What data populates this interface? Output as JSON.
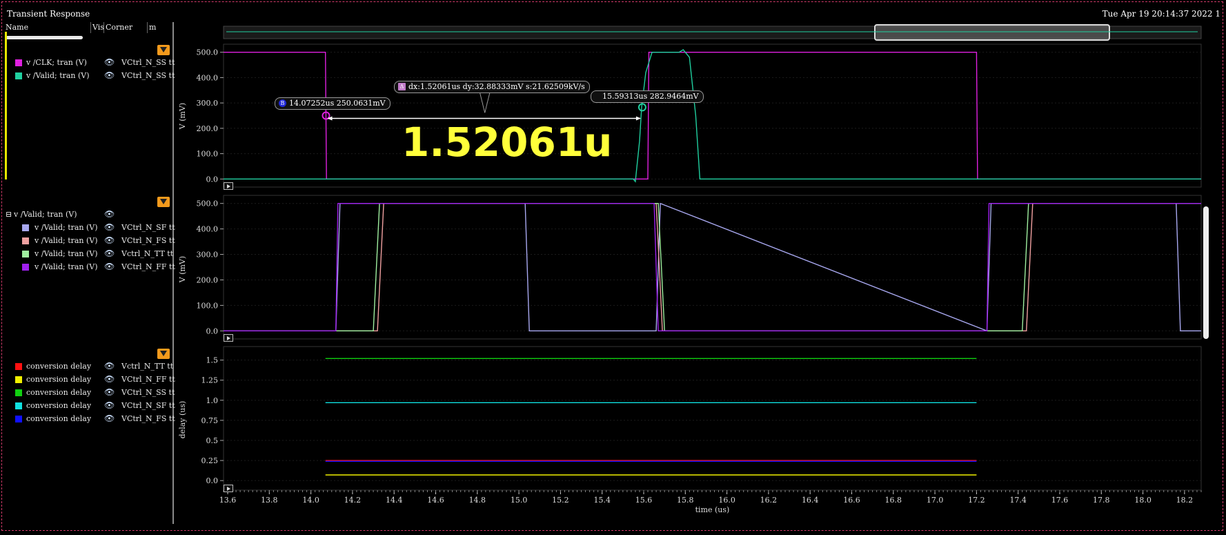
{
  "window": {
    "title": "Transient Response",
    "datetime": "Tue Apr 19 20:14:37 2022  1"
  },
  "browser": {
    "columns": {
      "name": "Name",
      "vis": "Vis",
      "corner": "Corner",
      "m": "m"
    }
  },
  "legend_groups": [
    {
      "items": [
        {
          "label": "v /CLK; tran (V)",
          "corner": "VCtrl_N_SS  tt",
          "color": "#e020e0"
        },
        {
          "label": "v /Valid; tran (V)",
          "corner": "VCtrl_N_SS  tt",
          "color": "#20d0a0"
        }
      ]
    },
    {
      "header": "v /Valid; tran (V)",
      "items": [
        {
          "label": "v /Valid; tran (V)",
          "corner": "VCtrl_N_SF  tt",
          "color": "#a8a8f0"
        },
        {
          "label": "v /Valid; tran (V)",
          "corner": "VCtrl_N_FS  tt",
          "color": "#f0a0a0"
        },
        {
          "label": "v /Valid; tran (V)",
          "corner": "Vctrl_N_TT  tt",
          "color": "#a0f0a0"
        },
        {
          "label": "v /Valid; tran (V)",
          "corner": "VCtrl_N_FF  tt",
          "color": "#a020f0"
        }
      ]
    },
    {
      "items": [
        {
          "label": "conversion delay",
          "corner": "Vctrl_N_TT  tt",
          "color": "#ff1010"
        },
        {
          "label": "conversion delay",
          "corner": "VCtrl_N_FF  tt",
          "color": "#f0f000"
        },
        {
          "label": "conversion delay",
          "corner": "VCtrl_N_SS  tt",
          "color": "#10d010"
        },
        {
          "label": "conversion delay",
          "corner": "VCtrl_N_SF  tt",
          "color": "#10e0e0"
        },
        {
          "label": "conversion delay",
          "corner": "VCtrl_N_FS  tt",
          "color": "#1010ff"
        }
      ]
    }
  ],
  "markers": {
    "a": {
      "label": "14.07252us 250.0631mV",
      "id": "B"
    },
    "b": {
      "label": "15.59313us 282.9464mV"
    },
    "delta": {
      "label": "dx:1.52061us dy:32.88333mV s:21.62509kV/s",
      "id": "Δ"
    }
  },
  "annotation": {
    "text": "1.52061u"
  },
  "colors": {
    "accent_frame": "#d23a6a",
    "annotation": "#ffff3a"
  },
  "chart_data": [
    {
      "type": "line",
      "ylabel": "V (mV)",
      "xlim": [
        13.58,
        18.28
      ],
      "ylim": [
        -10,
        510
      ],
      "yticks": [
        "0.0",
        "100.0",
        "200.0",
        "300.0",
        "400.0",
        "500.0"
      ],
      "series": [
        {
          "name": "v /CLK; tran (V)",
          "color": "#e020e0",
          "x": [
            13.58,
            14.07,
            14.075,
            15.62,
            15.625,
            17.2,
            17.205,
            18.28
          ],
          "y": [
            500,
            500,
            0,
            0,
            500,
            500,
            0,
            0
          ]
        },
        {
          "name": "v /Valid; tran (V)",
          "color": "#20d0a0",
          "x": [
            13.58,
            15.55,
            15.56,
            15.58,
            15.59,
            15.61,
            15.64,
            15.77,
            15.79,
            15.82,
            15.85,
            15.87,
            18.28
          ],
          "y": [
            0,
            0,
            -10,
            150,
            283,
            420,
            500,
            500,
            510,
            480,
            250,
            0,
            0
          ]
        }
      ]
    },
    {
      "type": "line",
      "ylabel": "V (mV)",
      "xlim": [
        13.58,
        18.28
      ],
      "ylim": [
        -10,
        510
      ],
      "yticks": [
        "0.0",
        "100.0",
        "200.0",
        "300.0",
        "400.0",
        "500.0"
      ],
      "series": [
        {
          "name": "v /Valid; tran (V) VCtrl_N_SF",
          "color": "#a8a8f0",
          "x": [
            13.58,
            14.12,
            14.14,
            15.03,
            15.05,
            15.66,
            15.68,
            17.25,
            17.27,
            18.16,
            18.18,
            18.28
          ],
          "y": [
            0,
            0,
            500,
            500,
            0,
            0,
            500,
            0,
            500,
            500,
            0,
            0
          ]
        },
        {
          "name": "v /Valid; tran (V) VCtrl_N_FS",
          "color": "#f0a0a0",
          "x": [
            13.58,
            14.32,
            14.35,
            15.66,
            15.69,
            17.44,
            17.47,
            18.28
          ],
          "y": [
            0,
            0,
            500,
            500,
            0,
            0,
            500,
            500
          ]
        },
        {
          "name": "v /Valid; tran (V) Vctrl_N_TT",
          "color": "#a0f0a0",
          "x": [
            13.58,
            14.3,
            14.33,
            15.67,
            15.7,
            17.42,
            17.45,
            18.28
          ],
          "y": [
            0,
            0,
            500,
            500,
            0,
            0,
            500,
            500
          ]
        },
        {
          "name": "v /Valid; tran (V) VCtrl_N_FF",
          "color": "#a020f0",
          "x": [
            13.58,
            14.12,
            14.13,
            15.65,
            15.67,
            17.25,
            17.26,
            18.28
          ],
          "y": [
            0,
            0,
            500,
            500,
            0,
            0,
            500,
            500
          ]
        }
      ]
    },
    {
      "type": "line",
      "ylabel": "delay (us)",
      "xlabel": "time (us)",
      "xlim": [
        13.58,
        18.28
      ],
      "ylim": [
        -0.05,
        1.6
      ],
      "yticks": [
        "0.0",
        "0.25",
        "0.5",
        "0.75",
        "1.0",
        "1.25",
        "1.5"
      ],
      "xticks": [
        "13.6",
        "13.8",
        "14.0",
        "14.2",
        "14.4",
        "14.6",
        "14.8",
        "15.0",
        "15.2",
        "15.4",
        "15.6",
        "15.8",
        "16.0",
        "16.2",
        "16.4",
        "16.6",
        "16.8",
        "17.0",
        "17.2",
        "17.4",
        "17.6",
        "17.8",
        "18.0",
        "18.2"
      ],
      "series": [
        {
          "name": "conversion delay Vctrl_N_TT",
          "color": "#ff1010",
          "x": [
            14.07,
            17.2
          ],
          "y": [
            0.25,
            0.25
          ]
        },
        {
          "name": "conversion delay VCtrl_N_FF",
          "color": "#f0f000",
          "x": [
            14.07,
            17.2
          ],
          "y": [
            0.07,
            0.07
          ]
        },
        {
          "name": "conversion delay VCtrl_N_SS",
          "color": "#10d010",
          "x": [
            14.07,
            17.2
          ],
          "y": [
            1.52,
            1.52
          ]
        },
        {
          "name": "conversion delay VCtrl_N_SF",
          "color": "#10e0e0",
          "x": [
            14.07,
            17.2
          ],
          "y": [
            0.97,
            0.97
          ]
        },
        {
          "name": "conversion delay VCtrl_N_FS",
          "color": "#1010ff",
          "x": [
            14.07,
            17.2
          ],
          "y": [
            0.24,
            0.24
          ]
        }
      ]
    }
  ]
}
